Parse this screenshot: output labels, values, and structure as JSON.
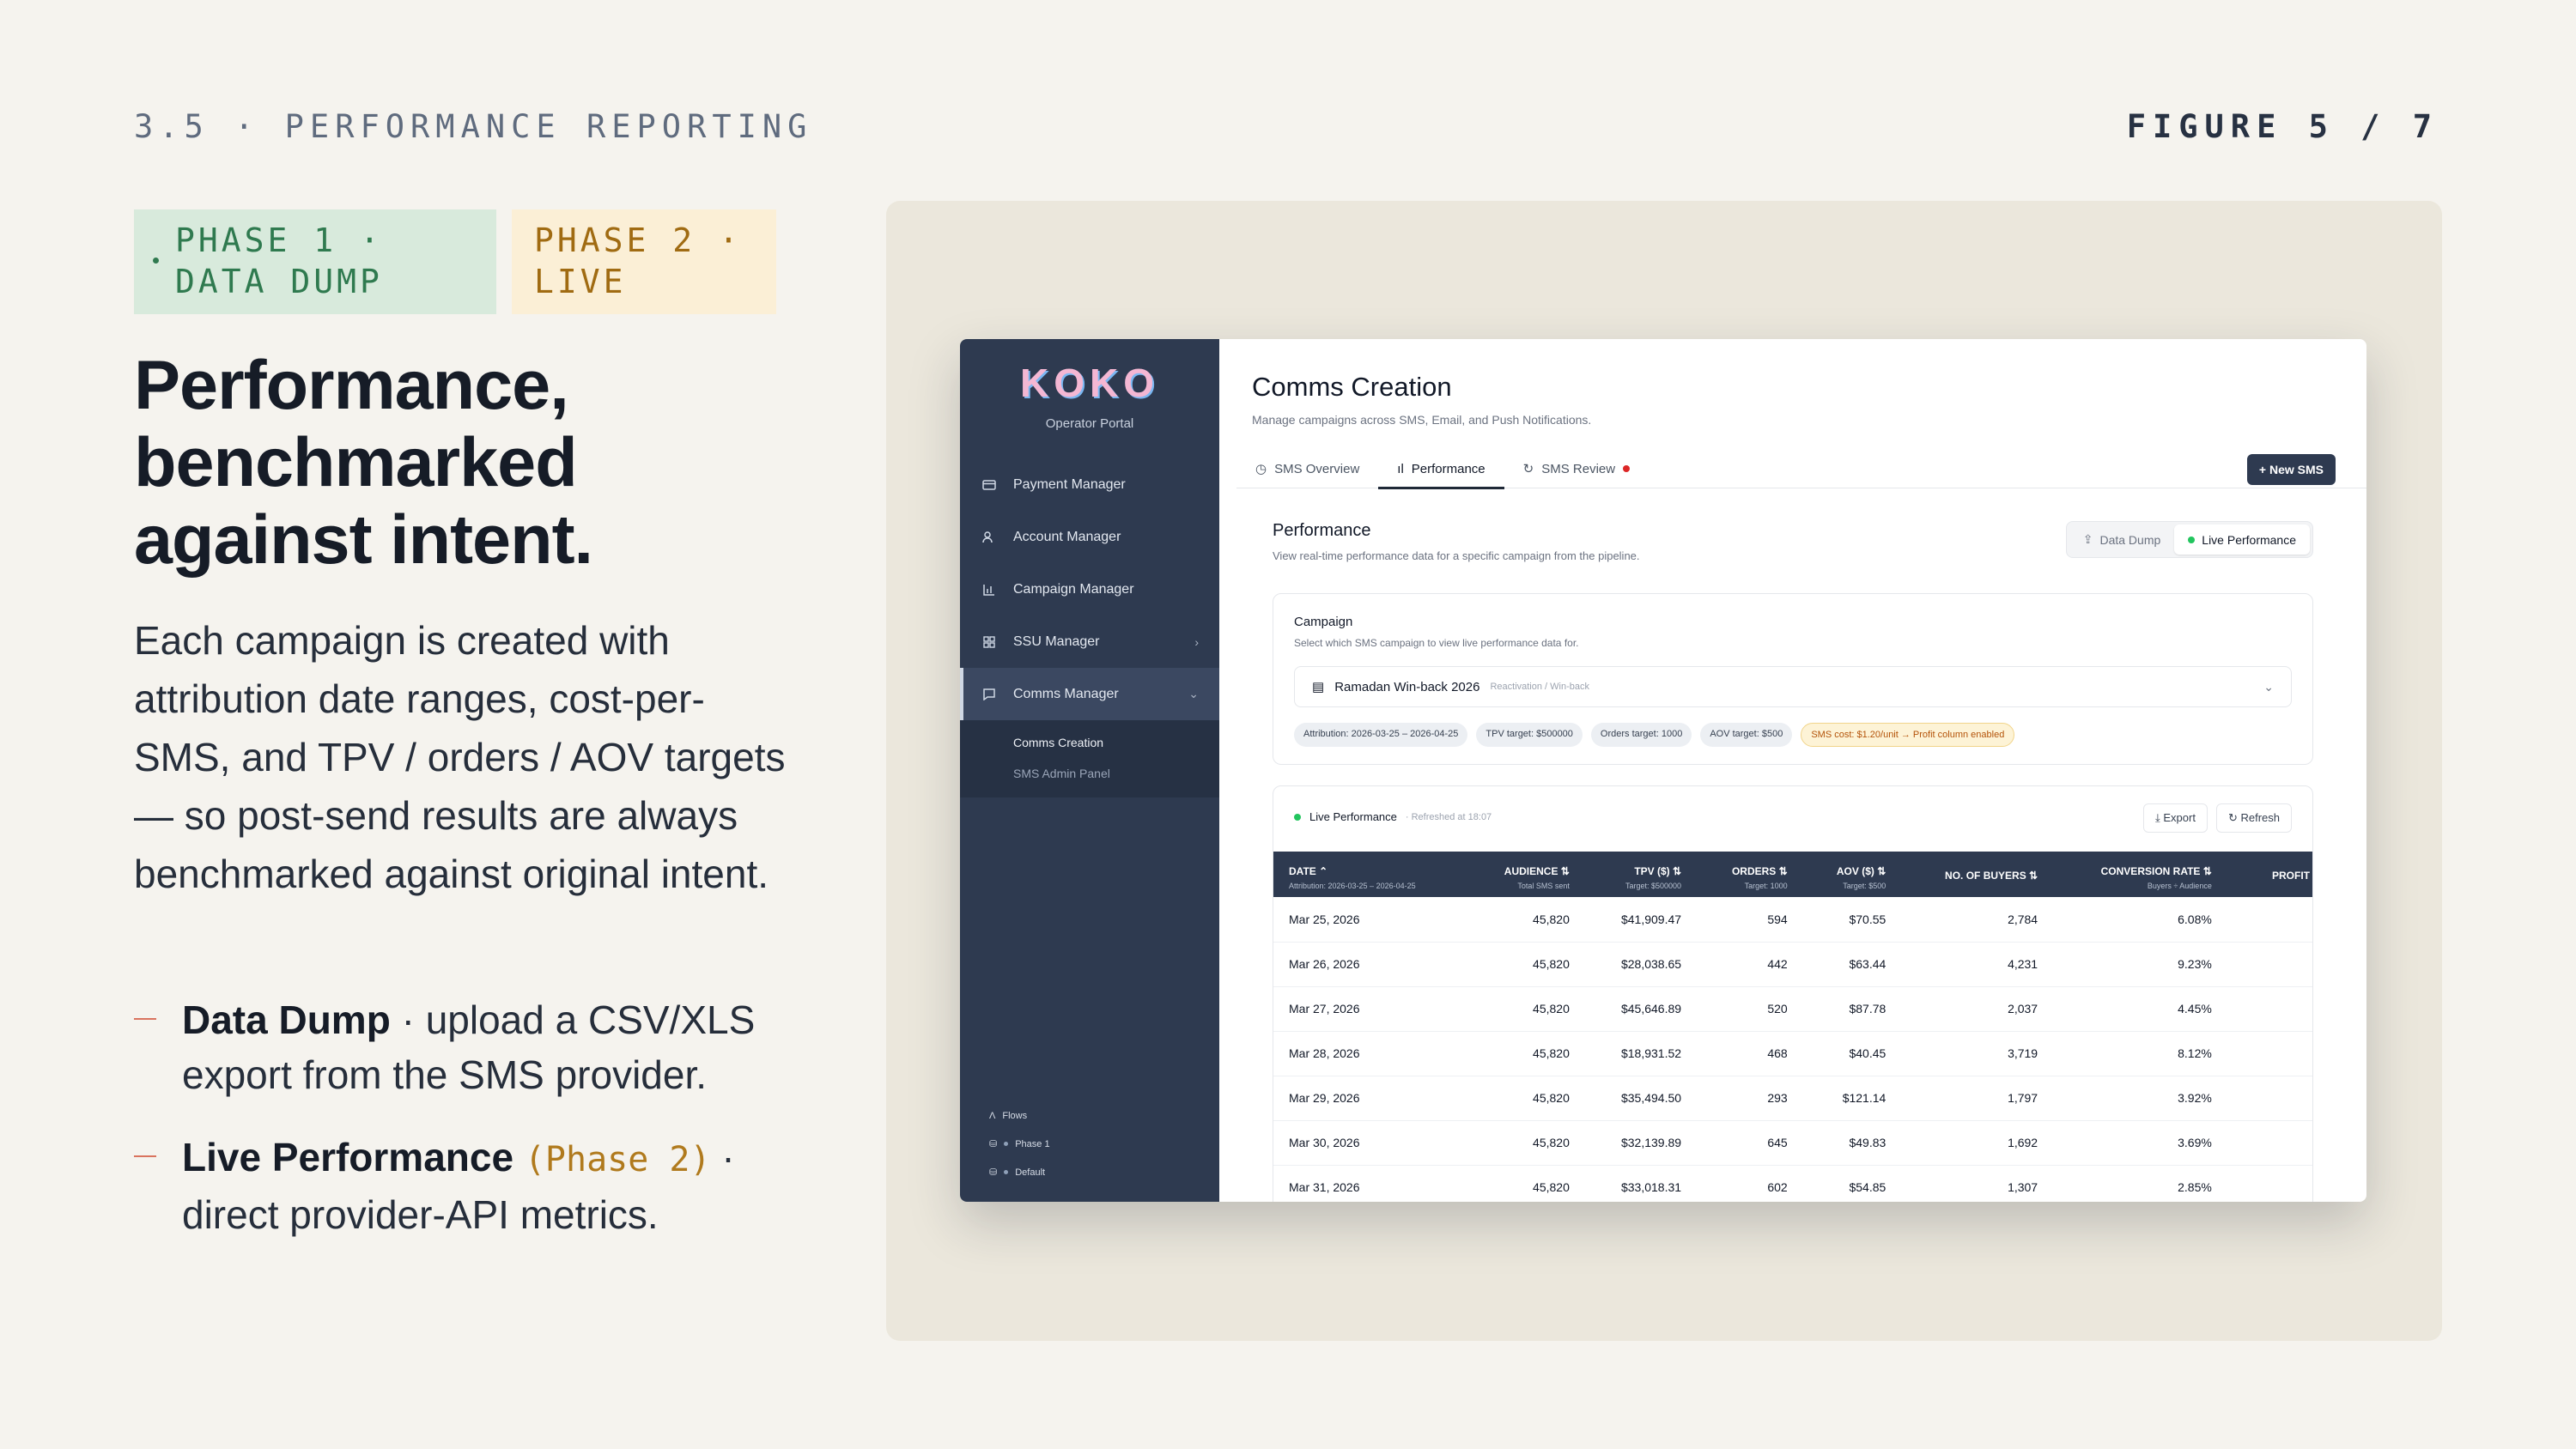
{
  "header": {
    "section": "3.5  ·  PERFORMANCE REPORTING",
    "figure": "FIGURE 5 / 7"
  },
  "phases": [
    {
      "label": "PHASE 1 · DATA DUMP"
    },
    {
      "label": "PHASE 2 · LIVE"
    }
  ],
  "headline": "Performance, benchmarked against intent.",
  "body": "Each campaign is created with attribution date ranges, cost-per-SMS, and TPV / orders / AOV targets — so post-send results are always benchmarked against original intent.",
  "bullets": [
    {
      "title": "Data Dump",
      "text": " · upload a CSV/XLS export from the SMS provider."
    },
    {
      "title": "Live Performance",
      "mono": "(Phase 2)",
      "text": " · direct provider-API metrics."
    }
  ],
  "app": {
    "logo": "KOKO",
    "portal": "Operator Portal",
    "nav": [
      {
        "label": "Payment Manager",
        "icon": "credit-card-icon"
      },
      {
        "label": "Account Manager",
        "icon": "users-icon"
      },
      {
        "label": "Campaign Manager",
        "icon": "bar-chart-icon"
      },
      {
        "label": "SSU Manager",
        "icon": "grid-icon"
      },
      {
        "label": "Comms Manager",
        "icon": "message-icon"
      }
    ],
    "sub_nav": [
      "Comms Creation",
      "SMS Admin Panel"
    ],
    "footer": [
      "Flows",
      "Phase 1",
      "Default"
    ],
    "title": "Comms Creation",
    "subtitle": "Manage campaigns across SMS, Email, and Push Notifications.",
    "tabs": [
      "SMS Overview",
      "Performance",
      "SMS Review"
    ],
    "new_button": "New SMS",
    "perf_title": "Performance",
    "perf_sub": "View real-time performance data for a specific campaign from the pipeline.",
    "modes": [
      "Data Dump",
      "Live Performance"
    ],
    "campaign_label": "Campaign",
    "campaign_help": "Select which SMS campaign to view live performance data for.",
    "campaign_selected": "Ramadan Win-back 2026",
    "campaign_tag": "Reactivation / Win-back",
    "chips": [
      "Attribution: 2026-03-25 – 2026-04-25",
      "TPV target: $500000",
      "Orders target: 1000",
      "AOV target: $500",
      "SMS cost: $1.20/unit → Profit column enabled"
    ],
    "live_label": "Live Performance",
    "refreshed": "· Refreshed at 18:07",
    "export": "Export",
    "refresh": "Refresh",
    "columns": [
      {
        "label": "DATE ⌃",
        "sub": "Attribution: 2026-03-25 – 2026-04-25"
      },
      {
        "label": "AUDIENCE ⇅",
        "sub": "Total SMS sent"
      },
      {
        "label": "TPV ($) ⇅",
        "sub": "Target: $500000"
      },
      {
        "label": "ORDERS ⇅",
        "sub": "Target: 1000"
      },
      {
        "label": "AOV ($) ⇅",
        "sub": "Target: $500"
      },
      {
        "label": "NO. OF BUYERS ⇅",
        "sub": ""
      },
      {
        "label": "CONVERSION RATE ⇅",
        "sub": "Buyers ÷ Audience"
      },
      {
        "label": "PROFIT (TPV – SMS",
        "sub": ""
      }
    ],
    "rows": [
      {
        "date": "Mar 25, 2026",
        "audience": "45,820",
        "tpv": "$41,909.47",
        "orders": "594",
        "aov": "$70.55",
        "buyers": "2,784",
        "conv": "6.08%",
        "profit": "$"
      },
      {
        "date": "Mar 26, 2026",
        "audience": "45,820",
        "tpv": "$28,038.65",
        "orders": "442",
        "aov": "$63.44",
        "buyers": "4,231",
        "conv": "9.23%",
        "profit": "$"
      },
      {
        "date": "Mar 27, 2026",
        "audience": "45,820",
        "tpv": "$45,646.89",
        "orders": "520",
        "aov": "$87.78",
        "buyers": "2,037",
        "conv": "4.45%",
        "profit": ""
      },
      {
        "date": "Mar 28, 2026",
        "audience": "45,820",
        "tpv": "$18,931.52",
        "orders": "468",
        "aov": "$40.45",
        "buyers": "3,719",
        "conv": "8.12%",
        "profit": "$"
      },
      {
        "date": "Mar 29, 2026",
        "audience": "45,820",
        "tpv": "$35,494.50",
        "orders": "293",
        "aov": "$121.14",
        "buyers": "1,797",
        "conv": "3.92%",
        "profit": "$"
      },
      {
        "date": "Mar 30, 2026",
        "audience": "45,820",
        "tpv": "$32,139.89",
        "orders": "645",
        "aov": "$49.83",
        "buyers": "1,692",
        "conv": "3.69%",
        "profit": "$"
      },
      {
        "date": "Mar 31, 2026",
        "audience": "45,820",
        "tpv": "$33,018.31",
        "orders": "602",
        "aov": "$54.85",
        "buyers": "1,307",
        "conv": "2.85%",
        "profit": "$"
      }
    ]
  }
}
